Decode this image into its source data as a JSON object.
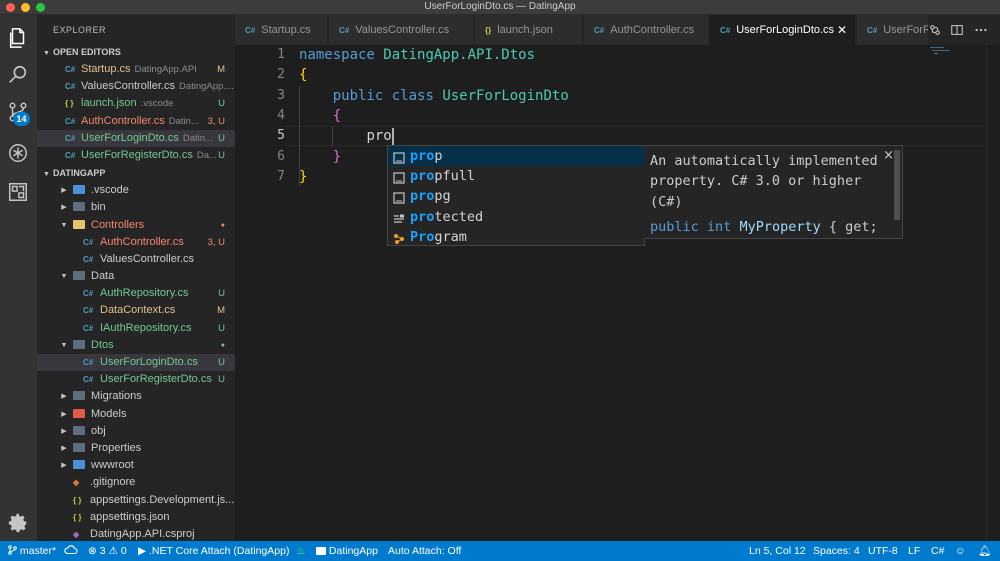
{
  "window": {
    "title": "UserForLoginDto.cs — DatingApp"
  },
  "activity": {
    "scm_badge": "14"
  },
  "explorer": {
    "title": "EXPLORER",
    "open_editors_label": "OPEN EDITORS",
    "open_editors": [
      {
        "name": "Startup.cs",
        "desc": "DatingApp.API",
        "flag": "M",
        "color": "#e2c08d",
        "icon": "csharp-icon"
      },
      {
        "name": "ValuesController.cs",
        "desc": "DatingApp....",
        "flag": "",
        "color": "#cccccc",
        "icon": "csharp-icon"
      },
      {
        "name": "launch.json",
        "desc": ".vscode",
        "flag": "U",
        "color": "#73c991",
        "icon": "json-icon"
      },
      {
        "name": "AuthController.cs",
        "desc": "Datin...",
        "flag": "3, U",
        "color": "#f48771",
        "icon": "csharp-icon"
      },
      {
        "name": "UserForLoginDto.cs",
        "desc": "Datin...",
        "flag": "U",
        "color": "#73c991",
        "icon": "csharp-icon"
      },
      {
        "name": "UserForRegisterDto.cs",
        "desc": "Da...",
        "flag": "U",
        "color": "#73c991",
        "icon": "csharp-icon"
      }
    ],
    "project_label": "DATINGAPP",
    "tree": [
      {
        "name": ".vscode",
        "depth": 1,
        "type": "folder",
        "open": false,
        "color": "#cccccc",
        "flag": "",
        "ficolor": "#4d8fd6"
      },
      {
        "name": "bin",
        "depth": 1,
        "type": "folder",
        "open": false,
        "color": "#cccccc",
        "flag": "",
        "ficolor": "#5d6e7e"
      },
      {
        "name": "Controllers",
        "depth": 1,
        "type": "folder",
        "open": true,
        "color": "#f48771",
        "flag": "●",
        "ficolor": "#e8c46a"
      },
      {
        "name": "AuthController.cs",
        "depth": 2,
        "type": "cs",
        "color": "#f48771",
        "flag": "3, U"
      },
      {
        "name": "ValuesController.cs",
        "depth": 2,
        "type": "cs",
        "color": "#cccccc",
        "flag": ""
      },
      {
        "name": "Data",
        "depth": 1,
        "type": "folder",
        "open": true,
        "color": "#cccccc",
        "flag": "",
        "ficolor": "#5d6e7e"
      },
      {
        "name": "AuthRepository.cs",
        "depth": 2,
        "type": "cs",
        "color": "#73c991",
        "flag": "U"
      },
      {
        "name": "DataContext.cs",
        "depth": 2,
        "type": "cs",
        "color": "#e2c08d",
        "flag": "M"
      },
      {
        "name": "IAuthRepository.cs",
        "depth": 2,
        "type": "cs",
        "color": "#73c991",
        "flag": "U"
      },
      {
        "name": "Dtos",
        "depth": 1,
        "type": "folder",
        "open": true,
        "color": "#73c991",
        "flag": "●",
        "ficolor": "#5d6e7e"
      },
      {
        "name": "UserForLoginDto.cs",
        "depth": 2,
        "type": "cs",
        "color": "#73c991",
        "flag": "U",
        "selected": true
      },
      {
        "name": "UserForRegisterDto.cs",
        "depth": 2,
        "type": "cs",
        "color": "#73c991",
        "flag": "U"
      },
      {
        "name": "Migrations",
        "depth": 1,
        "type": "folder",
        "open": false,
        "color": "#cccccc",
        "flag": "",
        "ficolor": "#5d6e7e"
      },
      {
        "name": "Models",
        "depth": 1,
        "type": "folder",
        "open": false,
        "color": "#cccccc",
        "flag": "",
        "ficolor": "#e05a47"
      },
      {
        "name": "obj",
        "depth": 1,
        "type": "folder",
        "open": false,
        "color": "#cccccc",
        "flag": "",
        "ficolor": "#5d6e7e"
      },
      {
        "name": "Properties",
        "depth": 1,
        "type": "folder",
        "open": false,
        "color": "#cccccc",
        "flag": "",
        "ficolor": "#5d6e7e"
      },
      {
        "name": "wwwroot",
        "depth": 1,
        "type": "folder",
        "open": false,
        "color": "#cccccc",
        "flag": "",
        "ficolor": "#4d8fd6"
      },
      {
        "name": ".gitignore",
        "depth": 1,
        "type": "git",
        "color": "#cccccc",
        "flag": ""
      },
      {
        "name": "appsettings.Development.js...",
        "depth": 1,
        "type": "json",
        "color": "#cccccc",
        "flag": ""
      },
      {
        "name": "appsettings.json",
        "depth": 1,
        "type": "json",
        "color": "#cccccc",
        "flag": ""
      },
      {
        "name": "DatingApp.API.csproj",
        "depth": 1,
        "type": "csproj",
        "color": "#cccccc",
        "flag": ""
      }
    ]
  },
  "tabs": [
    {
      "label": "Startup.cs",
      "icon": "C#",
      "active": false
    },
    {
      "label": "ValuesController.cs",
      "icon": "C#",
      "active": false
    },
    {
      "label": "launch.json",
      "icon": "{}",
      "active": false
    },
    {
      "label": "AuthController.cs",
      "icon": "C#",
      "active": false
    },
    {
      "label": "UserForLoginDto.cs",
      "icon": "C#",
      "active": true
    },
    {
      "label": "UserForR",
      "icon": "C#",
      "active": false
    }
  ],
  "editor": {
    "line_numbers": [
      "1",
      "2",
      "3",
      "4",
      "5",
      "6",
      "7"
    ],
    "current_line": 5,
    "lines": {
      "l1_kw": "namespace",
      "l1_ns": "DatingApp.API.Dtos",
      "l2": "{",
      "l3_kw1": "public",
      "l3_kw2": "class",
      "l3_type": "UserForLoginDto",
      "l4": "{",
      "l5": "pro",
      "l6": "}",
      "l7": "}"
    }
  },
  "suggest": {
    "items": [
      {
        "match": "pro",
        "rest": "p",
        "icon": "snippet-icon"
      },
      {
        "match": "pro",
        "rest": "pfull",
        "icon": "snippet-icon"
      },
      {
        "match": "pro",
        "rest": "pg",
        "icon": "snippet-icon"
      },
      {
        "match": "pro",
        "rest": "tected",
        "icon": "keyword-icon"
      },
      {
        "match": "Pro",
        "rest": "gram",
        "icon": "class-icon"
      }
    ],
    "doc_text": "An automatically implemented property. C# 3.0 or higher (C#)",
    "doc_code": {
      "kw1": "public",
      "kw2": "int",
      "name": "MyProperty",
      "rest": "{ get;"
    },
    "close": "×"
  },
  "status": {
    "branch": "master*",
    "errors": "3",
    "warnings": "0",
    "launch": ".NET Core Attach (DatingApp)",
    "folder": "DatingApp",
    "auto_attach": "Auto Attach: Off",
    "position": "Ln 5, Col 12",
    "spaces": "Spaces: 4",
    "encoding": "UTF-8",
    "eol": "LF",
    "language": "C#"
  }
}
